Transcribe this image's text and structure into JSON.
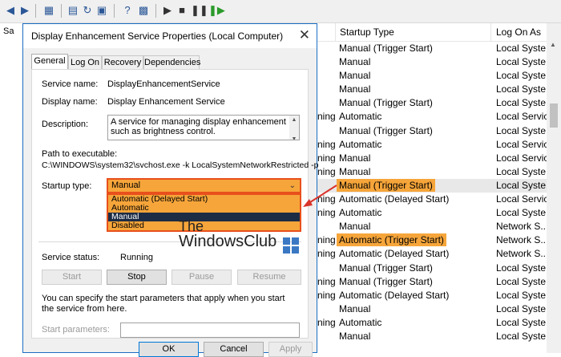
{
  "services": {
    "col_left_label": "Sa",
    "headers": {
      "startup_type": "Startup Type",
      "log_on_as": "Log On As"
    },
    "rows": [
      {
        "c1": "",
        "startup": "Manual (Trigger Start)",
        "logon": "Local Syste..."
      },
      {
        "c1": "",
        "startup": "Manual",
        "logon": "Local Syste..."
      },
      {
        "c1": "",
        "startup": "Manual",
        "logon": "Local Syste..."
      },
      {
        "c1": "",
        "startup": "Manual",
        "logon": "Local Syste..."
      },
      {
        "c1": "",
        "startup": "Manual (Trigger Start)",
        "logon": "Local Syste..."
      },
      {
        "c1": "ning",
        "startup": "Automatic",
        "logon": "Local Service"
      },
      {
        "c1": "",
        "startup": "Manual (Trigger Start)",
        "logon": "Local Syste..."
      },
      {
        "c1": "ning",
        "startup": "Automatic",
        "logon": "Local Service"
      },
      {
        "c1": "ning",
        "startup": "Manual",
        "logon": "Local Service"
      },
      {
        "c1": "ning",
        "startup": "Manual",
        "logon": "Local Syste..."
      },
      {
        "c1": "",
        "startup": "Manual (Trigger Start)",
        "logon": "Local Syste..."
      },
      {
        "c1": "ning",
        "startup": "Automatic (Delayed Start)",
        "logon": "Local Service"
      },
      {
        "c1": "ning",
        "startup": "Automatic",
        "logon": "Local Syste..."
      },
      {
        "c1": "",
        "startup": "Manual",
        "logon": "Network S..."
      },
      {
        "c1": "ning",
        "startup": "Automatic (Trigger Start)",
        "logon": "Network S..."
      },
      {
        "c1": "ning",
        "startup": "Automatic (Delayed Start)",
        "logon": "Network S..."
      },
      {
        "c1": "",
        "startup": "Manual (Trigger Start)",
        "logon": "Local Syste..."
      },
      {
        "c1": "ning",
        "startup": "Manual (Trigger Start)",
        "logon": "Local Syste..."
      },
      {
        "c1": "ning",
        "startup": "Automatic (Delayed Start)",
        "logon": "Local Syste..."
      },
      {
        "c1": "",
        "startup": "Manual",
        "logon": "Local Syste..."
      },
      {
        "c1": "ning",
        "startup": "Automatic",
        "logon": "Local Syste..."
      },
      {
        "c1": "",
        "startup": "Manual",
        "logon": "Local Syste..."
      }
    ],
    "highlighted_rows": [
      10,
      14
    ],
    "highlight_color": "#f6a53a"
  },
  "dialog": {
    "title": "Display Enhancement Service Properties (Local Computer)",
    "tabs": [
      "General",
      "Log On",
      "Recovery",
      "Dependencies"
    ],
    "active_tab": "General",
    "service_name_label": "Service name:",
    "service_name": "DisplayEnhancementService",
    "display_name_label": "Display name:",
    "display_name": "Display Enhancement Service",
    "description_label": "Description:",
    "description": "A service for managing display enhancement such as brightness control.",
    "path_label": "Path to executable:",
    "path": "C:\\WINDOWS\\system32\\svchost.exe -k LocalSystemNetworkRestricted -p",
    "startup_type_label": "Startup type:",
    "startup_type_value": "Manual",
    "startup_options": [
      "Automatic (Delayed Start)",
      "Automatic",
      "Manual",
      "Disabled"
    ],
    "selected_option": "Manual",
    "service_status_label": "Service status:",
    "service_status": "Running",
    "buttons": {
      "start": "Start",
      "stop": "Stop",
      "pause": "Pause",
      "resume": "Resume"
    },
    "start_params_hint": "You can specify the start parameters that apply when you start the service from here.",
    "start_params_label": "Start parameters:",
    "footer": {
      "ok": "OK",
      "cancel": "Cancel",
      "apply": "Apply"
    }
  },
  "watermark": {
    "line1": "The",
    "line2": "WindowsClub"
  },
  "colors": {
    "accent": "#1b6ec2",
    "dropdown_bg": "#f6a53a",
    "dropdown_border": "#e8501c",
    "selected_option": "#1d2c45",
    "arrow": "#d9342b"
  }
}
